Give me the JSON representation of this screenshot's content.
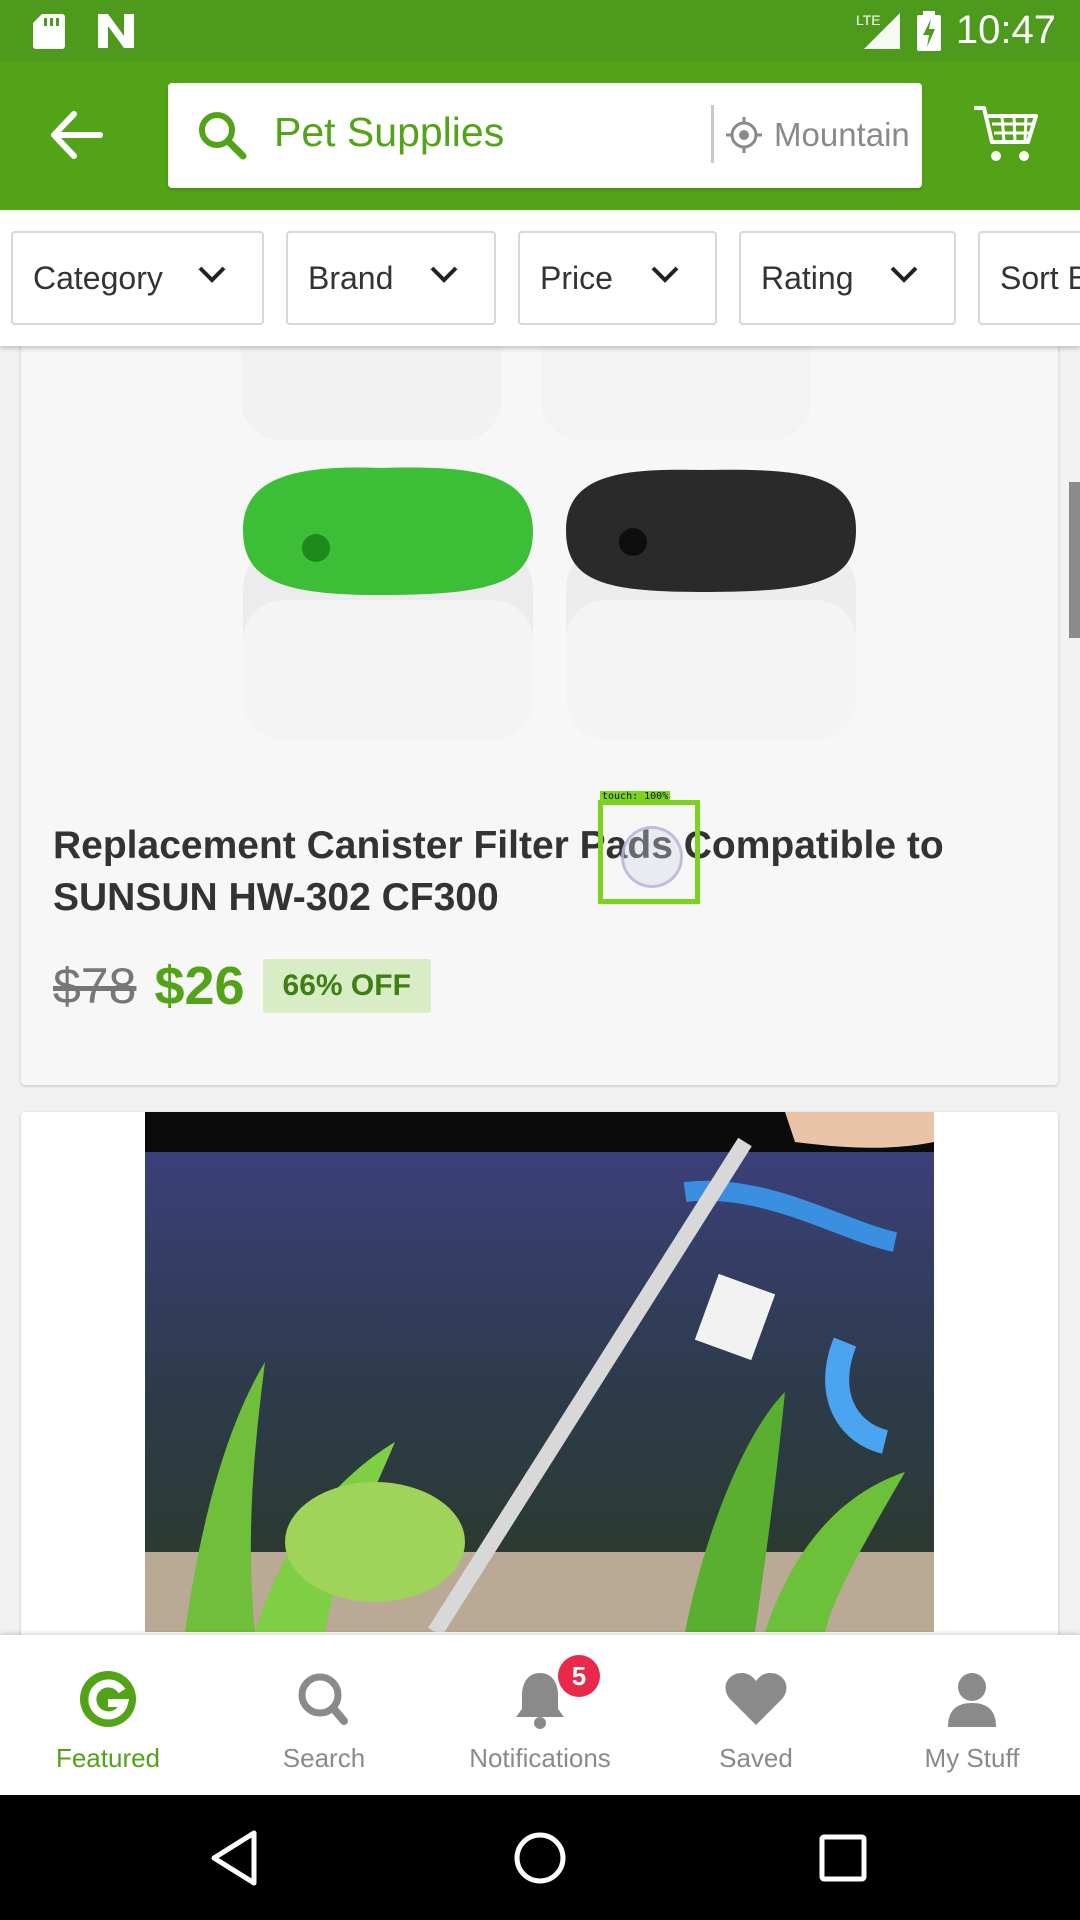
{
  "status_bar": {
    "time": "10:47",
    "network": "LTE",
    "icons": [
      "sd-card-icon",
      "n-notification-icon",
      "signal-icon",
      "battery-charging-icon"
    ]
  },
  "app_bar": {
    "back_icon": "arrow-left-icon",
    "search_query": "Pet Supplies",
    "location_text": "Mountain View",
    "cart_icon": "cart-icon"
  },
  "filters": [
    {
      "label": "Category"
    },
    {
      "label": "Brand"
    },
    {
      "label": "Price"
    },
    {
      "label": "Rating"
    },
    {
      "label": "Sort By"
    }
  ],
  "products": [
    {
      "title": "Replacement Canister Filter Pads Compatible to SUNSUN HW-302 CF300",
      "old_price": "$78",
      "price": "$26",
      "discount": "66% OFF"
    }
  ],
  "touch_indicator": "touch: 100%",
  "bottom_nav": {
    "items": [
      {
        "label": "Featured",
        "icon": "groupon-g-icon",
        "active": true
      },
      {
        "label": "Search",
        "icon": "search-icon"
      },
      {
        "label": "Notifications",
        "icon": "bell-icon",
        "badge": "5"
      },
      {
        "label": "Saved",
        "icon": "heart-icon"
      },
      {
        "label": "My Stuff",
        "icon": "person-icon"
      }
    ]
  },
  "colors": {
    "brand_green": "#53a318",
    "status_green": "#4e9a1c",
    "badge_red": "#e8294a"
  }
}
